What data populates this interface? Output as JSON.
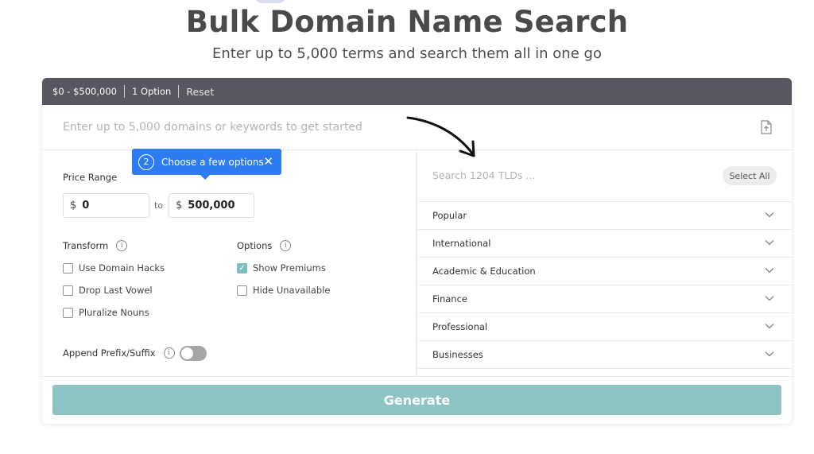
{
  "header": {
    "title": "Bulk Domain Name Search",
    "subtitle": "Enter up to 5,000 terms and search them all in one go"
  },
  "topbar": {
    "price_summary": "$0 - $500,000",
    "option_summary": "1 Option",
    "reset_label": "Reset"
  },
  "search": {
    "placeholder": "Enter up to 5,000 domains or keywords to get started",
    "upload_icon": "upload-file-icon"
  },
  "tooltip": {
    "step": "2",
    "text": "Choose a few options",
    "close": "✕"
  },
  "price": {
    "label": "Price Range",
    "currency": "$",
    "min": "0",
    "to_label": "to",
    "max": "500,000"
  },
  "transform": {
    "label": "Transform",
    "items": [
      {
        "label": "Use Domain Hacks",
        "checked": false
      },
      {
        "label": "Drop Last Vowel",
        "checked": false
      },
      {
        "label": "Pluralize Nouns",
        "checked": false
      }
    ]
  },
  "options": {
    "label": "Options",
    "items": [
      {
        "label": "Show Premiums",
        "checked": true
      },
      {
        "label": "Hide Unavailable",
        "checked": false
      }
    ]
  },
  "append": {
    "label": "Append Prefix/Suffix",
    "enabled": false
  },
  "tlds": {
    "search_placeholder": "Search 1204 TLDs ...",
    "select_all_label": "Select All",
    "categories": [
      "Popular",
      "International",
      "Academic & Education",
      "Finance",
      "Professional",
      "Businesses"
    ]
  },
  "actions": {
    "generate_label": "Generate"
  },
  "colors": {
    "topbar_bg": "#57575f",
    "tooltip_bg": "#2d7cf2",
    "generate_bg": "#8ec4c3",
    "checkbox_on": "#7fbec0"
  }
}
